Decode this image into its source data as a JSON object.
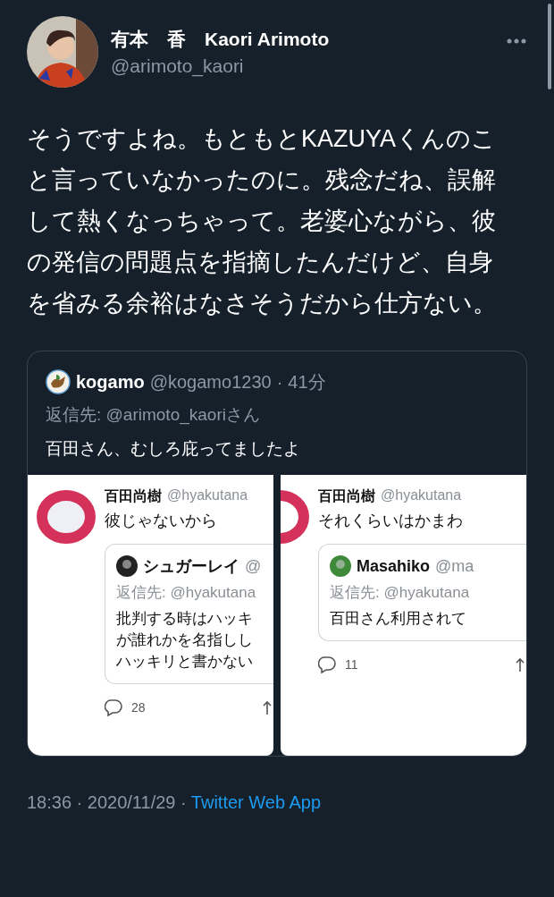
{
  "author": {
    "name": "有本　香　Kaori Arimoto",
    "handle": "@arimoto_kaori"
  },
  "text": "そうですよね。もともとKAZUYAくんのこと言っていなかったのに。残念だね、誤解して熱くなっちゃって。老婆心ながら、彼の発信の問題点を指摘したんだけど、自身を省みる余裕はなさそうだから仕方ない。",
  "quoted": {
    "name": "kogamo",
    "handle": "@kogamo1230",
    "separator": "·",
    "time": "41分",
    "reply_to": "返信先: @arimoto_kaoriさん",
    "text": "百田さん、むしろ庇ってましたよ",
    "images": [
      {
        "avatar_cut": false,
        "name": "百田尚樹",
        "handle": "@hyakutana",
        "text": "彼じゃないから",
        "quote": {
          "name": "シュガーレイ",
          "handle": "@",
          "color": "#222222",
          "reply_to": "返信先: @hyakutana",
          "lines": [
            "批判する時はハッキ",
            "が誰れかを名指しし",
            "ハッキリと書かない"
          ]
        },
        "replies": "28"
      },
      {
        "avatar_cut": true,
        "name": "百田尚樹",
        "handle": "@hyakutana",
        "text": "それくらいはかまわ",
        "quote": {
          "name": "Masahiko",
          "handle": "@ma",
          "color": "#3f8a3a",
          "reply_to": "返信先: @hyakutana",
          "lines": [
            "百田さん利用されて"
          ]
        },
        "replies": "11"
      }
    ]
  },
  "footer": {
    "time": "18:36 · 2020/11/29 · ",
    "source": "Twitter Web App"
  }
}
